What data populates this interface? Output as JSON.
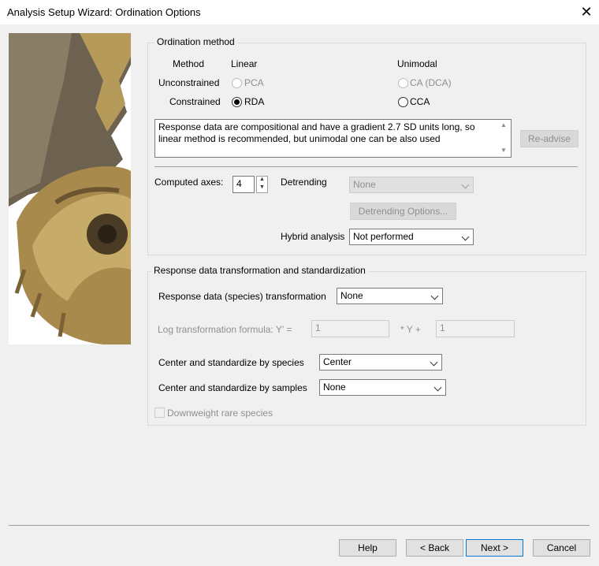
{
  "window": {
    "title": "Analysis Setup Wizard: Ordination Options",
    "close_glyph": "✕"
  },
  "ordination": {
    "group_label": "Ordination method",
    "method_label": "Method",
    "linear_label": "Linear",
    "unimodal_label": "Unimodal",
    "unconstrained_label": "Unconstrained",
    "constrained_label": "Constrained",
    "pca_label": "PCA",
    "ca_label": "CA (DCA)",
    "rda_label": "RDA",
    "cca_label": "CCA",
    "selected": "RDA",
    "advice_text": "Response data are compositional and have a gradient 2.7 SD units long, so linear method is recommended, but unimodal one can be also used",
    "readvise_label": "Re-advise",
    "computed_axes_label": "Computed axes:",
    "computed_axes_value": "4",
    "detrending_label": "Detrending",
    "detrending_value": "None",
    "detrending_options_label": "Detrending Options...",
    "hybrid_label": "Hybrid analysis",
    "hybrid_value": "Not performed"
  },
  "transform": {
    "group_label": "Response data transformation and standardization",
    "species_transform_label": "Response data (species) transformation",
    "species_transform_value": "None",
    "log_formula_label": "Log transformation formula: Y' =",
    "log_a_value": "1",
    "times_y_plus": "* Y +",
    "log_b_value": "1",
    "center_species_label": "Center and standardize by species",
    "center_species_value": "Center",
    "center_samples_label": "Center and standardize by samples",
    "center_samples_value": "None",
    "downweight_label": "Downweight rare species"
  },
  "footer": {
    "help": "Help",
    "back": "< Back",
    "next": "Next >",
    "cancel": "Cancel"
  }
}
